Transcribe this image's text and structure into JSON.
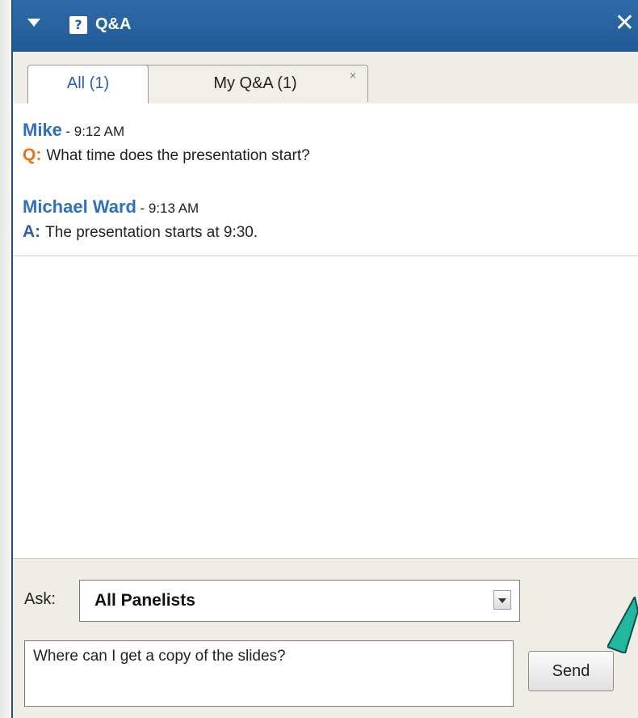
{
  "panel": {
    "title": "Q&A",
    "title_icon": "question-mark-icon",
    "collapse_icon": "triangle-down-icon",
    "close_icon": "close-icon"
  },
  "tabs": [
    {
      "label": "All (1)",
      "active": true
    },
    {
      "label": "My Q&A (1)",
      "active": false,
      "close_glyph": "×"
    }
  ],
  "messages": [
    {
      "author": "Mike",
      "time": "- 9:12 AM",
      "prefix": "Q:",
      "text": "What time does the presentation start?"
    },
    {
      "author": "Michael Ward",
      "time": "- 9:13 AM",
      "prefix": "A:",
      "text": "The presentation starts at 9:30."
    }
  ],
  "ask": {
    "label": "Ask:",
    "selected": "All Panelists",
    "question_value": "Where can I get a copy of the slides?",
    "send_label": "Send"
  },
  "colors": {
    "titlebar": "#2a62a1",
    "author": "#2d70c1",
    "question_prefix": "#e8741a",
    "answer_prefix": "#2d5ea8",
    "arrow": "#22b8a0"
  }
}
